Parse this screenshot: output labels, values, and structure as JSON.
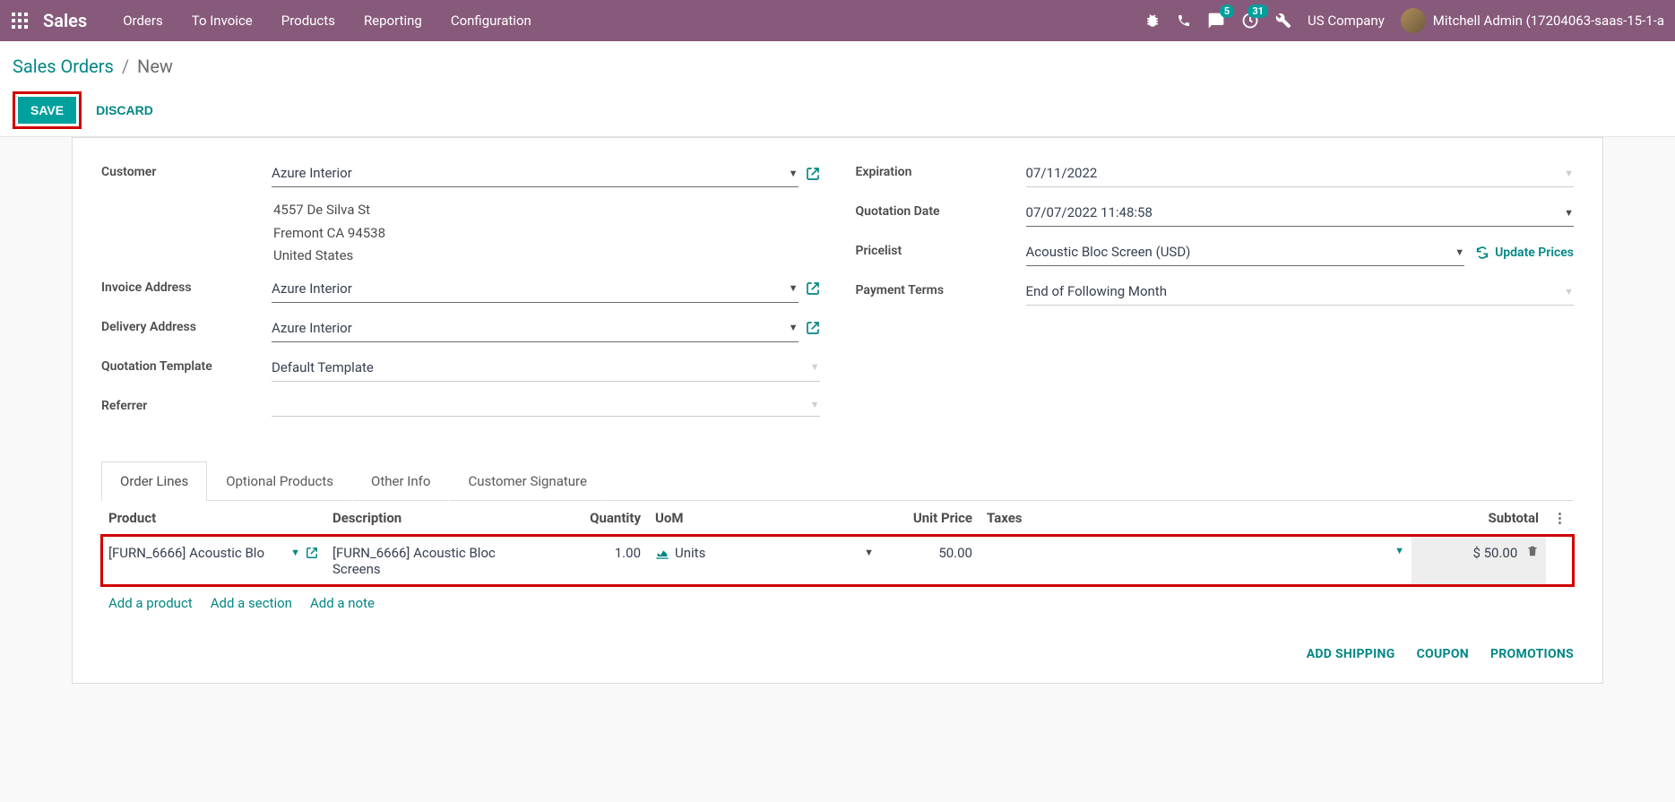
{
  "nav": {
    "brand": "Sales",
    "links": [
      "Orders",
      "To Invoice",
      "Products",
      "Reporting",
      "Configuration"
    ],
    "company": "US Company",
    "user": "Mitchell Admin (17204063-saas-15-1-a",
    "msg_badge": "5",
    "activity_badge": "31"
  },
  "breadcrumb": {
    "root": "Sales Orders",
    "current": "New"
  },
  "buttons": {
    "save": "SAVE",
    "discard": "DISCARD"
  },
  "form": {
    "labels": {
      "customer": "Customer",
      "invoice_addr": "Invoice Address",
      "delivery_addr": "Delivery Address",
      "quote_tmpl": "Quotation Template",
      "referrer": "Referrer",
      "expiration": "Expiration",
      "quote_date": "Quotation Date",
      "pricelist": "Pricelist",
      "payment_terms": "Payment Terms"
    },
    "customer": "Azure Interior",
    "address": {
      "street": "4557 De Silva St",
      "city": "Fremont CA 94538",
      "country": "United States"
    },
    "invoice_addr": "Azure Interior",
    "delivery_addr": "Azure Interior",
    "quote_tmpl": "Default Template",
    "referrer": "",
    "expiration": "07/11/2022",
    "quote_date": "07/07/2022 11:48:58",
    "pricelist": "Acoustic Bloc Screen (USD)",
    "update_prices": "Update Prices",
    "payment_terms": "End of Following Month"
  },
  "tabs": [
    "Order Lines",
    "Optional Products",
    "Other Info",
    "Customer Signature"
  ],
  "table": {
    "headers": {
      "product": "Product",
      "description": "Description",
      "quantity": "Quantity",
      "uom": "UoM",
      "unit_price": "Unit Price",
      "taxes": "Taxes",
      "subtotal": "Subtotal"
    },
    "row": {
      "product": "[FURN_6666] Acoustic Blo",
      "description": "[FURN_6666] Acoustic Bloc Screens",
      "quantity": "1.00",
      "uom": "Units",
      "unit_price": "50.00",
      "taxes": "",
      "subtotal": "$ 50.00"
    },
    "add": {
      "product": "Add a product",
      "section": "Add a section",
      "note": "Add a note"
    }
  },
  "footer": {
    "shipping": "ADD SHIPPING",
    "coupon": "COUPON",
    "promotions": "PROMOTIONS"
  }
}
